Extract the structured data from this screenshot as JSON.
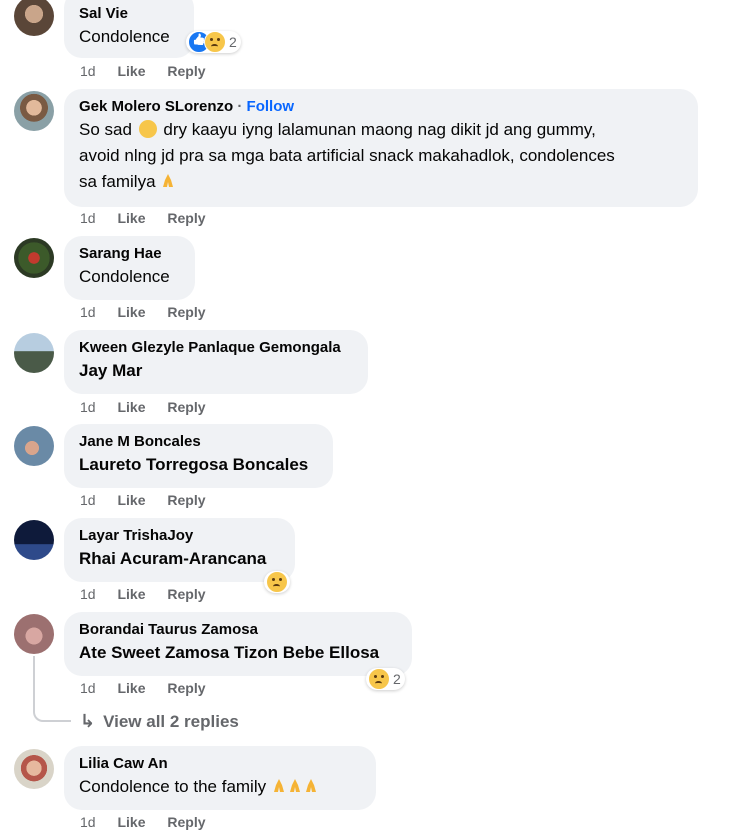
{
  "comments": [
    {
      "author": "Sal Vie",
      "text": "Condolence",
      "time": "1d",
      "like": "Like",
      "reply": "Reply",
      "reaction_count": "2"
    },
    {
      "author": "Gek Molero SLorenzo",
      "follow": "Follow",
      "separator": "·",
      "line1": "So sad",
      "line1b": "dry kaayu iyng lalamunan maong nag dikit jd ang gummy,",
      "line2": "avoid nlng jd pra sa mga bata artificial snack makahadlok, condolences",
      "line3": "sa familya",
      "time": "1d",
      "like": "Like",
      "reply": "Reply"
    },
    {
      "author": "Sarang Hae",
      "text": "Condolence",
      "time": "1d",
      "like": "Like",
      "reply": "Reply"
    },
    {
      "author": "Kween Glezyle Panlaque Gemongala",
      "text": "Jay Mar",
      "time": "1d",
      "like": "Like",
      "reply": "Reply"
    },
    {
      "author": "Jane M Boncales",
      "text": "Laureto Torregosa Boncales",
      "time": "1d",
      "like": "Like",
      "reply": "Reply"
    },
    {
      "author": "Layar TrishaJoy",
      "text": "Rhai Acuram-Arancana",
      "time": "1d",
      "like": "Like",
      "reply": "Reply"
    },
    {
      "author": "Borandai Taurus Zamosa",
      "text": "Ate Sweet Zamosa Tizon Bebe Ellosa",
      "time": "1d",
      "like": "Like",
      "reply": "Reply",
      "reaction_count": "2"
    },
    {
      "author": "Lilia Caw An",
      "text": "Condolence to the family",
      "time": "1d",
      "like": "Like",
      "reply": "Reply"
    }
  ],
  "view_replies": "View all 2 replies",
  "colors": {
    "bubble": "#f0f2f5",
    "meta": "#65676b",
    "follow": "#0866ff"
  }
}
